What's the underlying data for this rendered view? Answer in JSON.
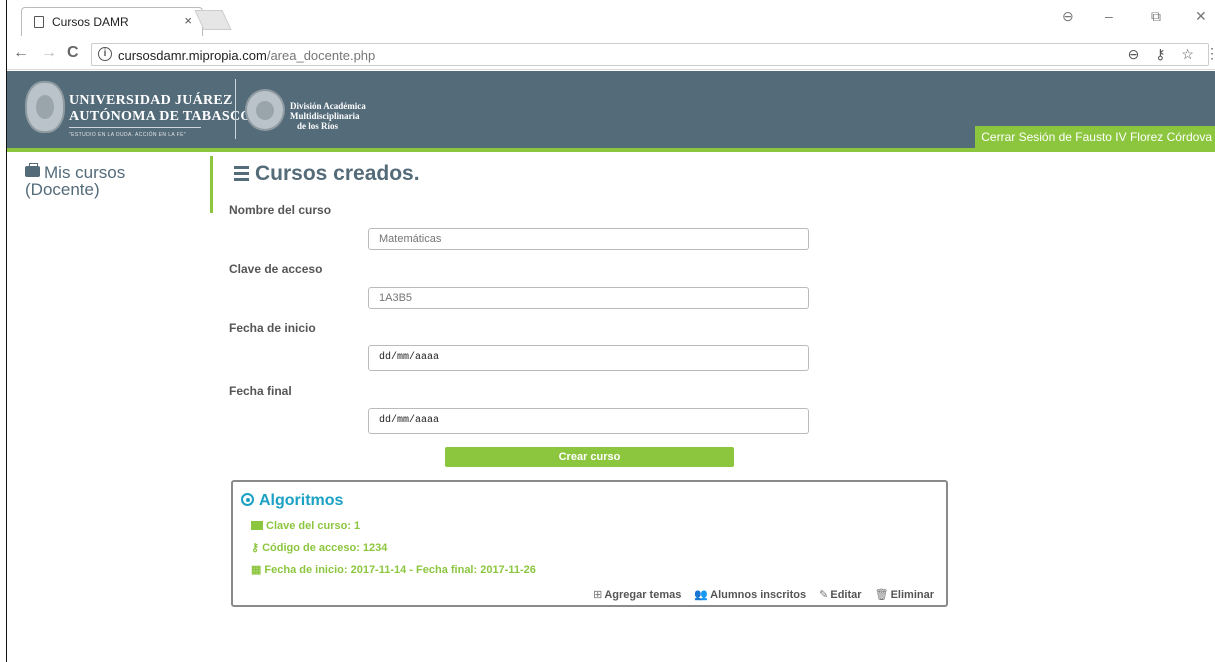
{
  "browser": {
    "tab_title": "Cursos DAMR",
    "tab_close": "×",
    "url_host": "cursosdamr.mipropia.com",
    "url_path": "/area_docente.php",
    "back": "←",
    "forward": "→",
    "reload": "C",
    "omni_icons": "⊖ ⚷ ☆",
    "menu": "⋮",
    "win_account": "⊖",
    "win_minimize": "–",
    "win_restore": "⧉",
    "win_close": "✕"
  },
  "header": {
    "university_line1": "UNIVERSIDAD JUÁREZ",
    "university_line2": "AUTÓNOMA DE TABASCO",
    "university_motto": "\"ESTUDIO EN LA DUDA. ACCIÓN EN LA FE\"",
    "division_line1": "División Académica",
    "division_line2": "Multidisciplinaria",
    "division_line3": "de los Ríos",
    "logout_label": "Cerrar Sesión de Fausto IV Florez Córdova"
  },
  "sidebar": {
    "line1": "Mis cursos",
    "line2": "(Docente)"
  },
  "main": {
    "title": "Cursos creados.",
    "fields": {
      "name_label": "Nombre del curso",
      "name_placeholder": "Matemáticas",
      "key_label": "Clave de acceso",
      "key_placeholder": "1A3B5",
      "start_label": "Fecha de inicio",
      "start_value": "dd/mm/aaaa",
      "end_label": "Fecha final",
      "end_value": "dd/mm/aaaa"
    },
    "create_button": "Crear curso"
  },
  "course": {
    "title": "Algoritmos",
    "clave": "Clave del curso: 1",
    "codigo": "Código de acceso: 1234",
    "fechas": "Fecha de inicio: 2017-11-14 - Fecha final: 2017-11-26",
    "actions": {
      "agregar": "Agregar temas",
      "alumnos": "Alumnos inscritos",
      "editar": "Editar",
      "eliminar": "Eliminar"
    }
  },
  "colors": {
    "header_bg": "#546b7a",
    "accent_green": "#8cc63f",
    "course_title": "#1ba1c4"
  }
}
